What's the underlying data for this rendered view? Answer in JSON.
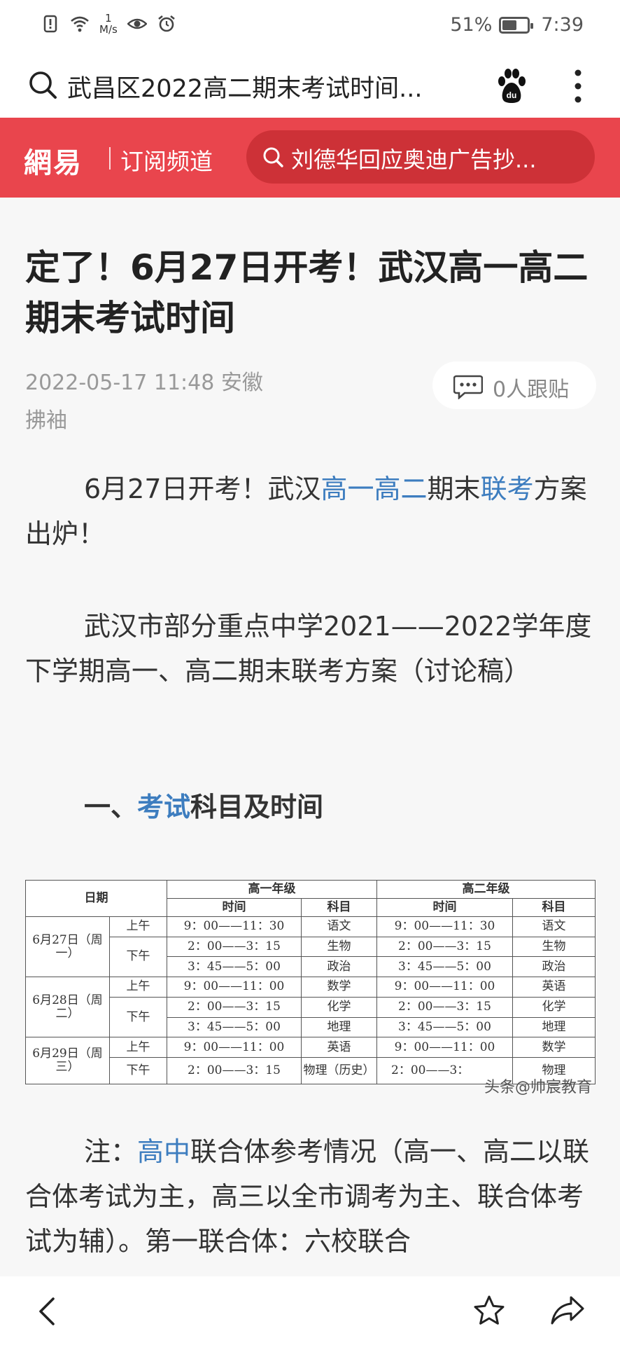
{
  "status_bar": {
    "net_speed_value": "1",
    "net_speed_unit": "M/s",
    "battery_text": "51%",
    "battery_level": 0.51,
    "time": "7:39"
  },
  "search": {
    "query": "武昌区2022高二期末考试时间..."
  },
  "header": {
    "logo": "網易",
    "channel": "订阅频道",
    "search_placeholder": "刘德华回应奥迪广告抄..."
  },
  "article": {
    "title": "定了！6月27日开考！武汉高一高二期末考试时间",
    "meta_line1": "2022-05-17 11:48 安徽",
    "meta_line2": "拂袖",
    "comment_label": "0人跟贴",
    "p1_a": "6月27日开考！武汉",
    "p1_link1": "高一高二",
    "p1_b": "期末",
    "p1_link2": "联考",
    "p1_c": "方案出炉！",
    "p2": "武汉市部分重点中学2021——2022学年度下学期高一、高二期末联考方案（讨论稿）",
    "h_a": "一、",
    "h_link": "考试",
    "h_b": "科目及时间",
    "p4_a": "注：",
    "p4_link": "高中",
    "p4_b": "联合体参考情况（高一、高二以联合体考试为主，高三以全市调考为主、联合体考试为辅）。第一联合体：六校联合"
  },
  "table": {
    "h_date": "日期",
    "h_g1": "高一年级",
    "h_g2": "高二年级",
    "h_time": "时间",
    "h_subject": "科目",
    "d1": "6月27日（周一）",
    "d2": "6月28日（周二）",
    "d3": "6月29日（周三）",
    "am": "上午",
    "pm": "下午",
    "rows": [
      {
        "t1": "9：00——11：30",
        "s1": "语文",
        "t2": "9：00——11：30",
        "s2": "语文"
      },
      {
        "t1": "2：00——3：15",
        "s1": "生物",
        "t2": "2：00——3：15",
        "s2": "生物"
      },
      {
        "t1": "3：45——5：00",
        "s1": "政治",
        "t2": "3：45——5：00",
        "s2": "政治"
      },
      {
        "t1": "9：00——11：00",
        "s1": "数学",
        "t2": "9：00——11：00",
        "s2": "英语"
      },
      {
        "t1": "2：00——3：15",
        "s1": "化学",
        "t2": "2：00——3：15",
        "s2": "化学"
      },
      {
        "t1": "3：45——5：00",
        "s1": "地理",
        "t2": "3：45——5：00",
        "s2": "地理"
      },
      {
        "t1": "9：00——11：00",
        "s1": "英语",
        "t2": "9：00——11：00",
        "s2": "数学"
      },
      {
        "t1": "2：00——3：15",
        "s1": "物理（历史）",
        "t2": "2：00——3：",
        "s2": "物理"
      }
    ],
    "watermark": "头条@帅宸教育"
  },
  "colors": {
    "brand_red": "#e9454d",
    "link_blue": "#3d7dbf"
  },
  "icons": [
    "search-icon",
    "baidu-paw-icon",
    "more-icon",
    "comment-icon",
    "back-icon",
    "star-icon",
    "share-icon"
  ]
}
